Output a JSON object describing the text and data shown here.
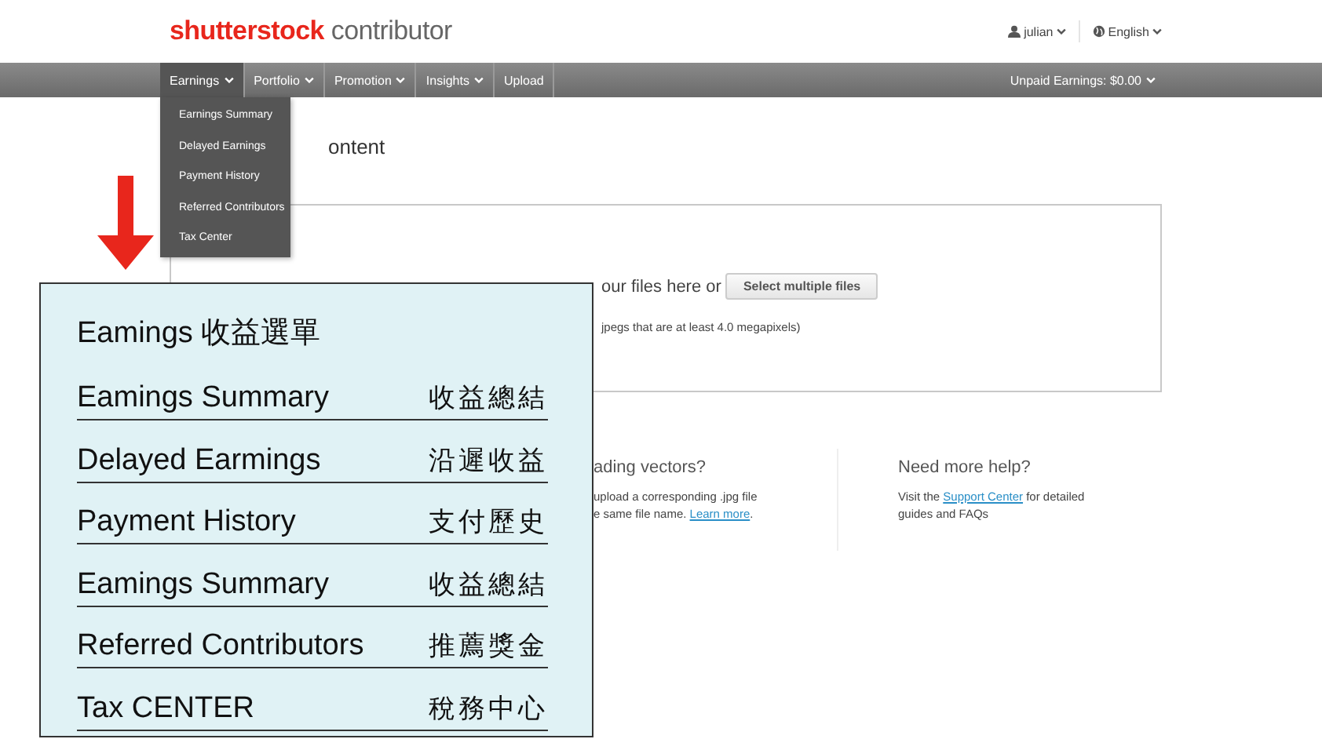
{
  "header": {
    "logo_brand": "shutterstock",
    "logo_product": "contributor",
    "user": "julian",
    "language": "English"
  },
  "nav": {
    "items": [
      {
        "label": "Earnings",
        "selected": true,
        "caret": true
      },
      {
        "label": "Portfolio",
        "selected": false,
        "caret": true
      },
      {
        "label": "Promotion",
        "selected": false,
        "caret": true
      },
      {
        "label": "Insights",
        "selected": false,
        "caret": true
      },
      {
        "label": "Upload",
        "selected": false,
        "caret": false
      }
    ],
    "unpaid": "Unpaid Earnings: $0.00"
  },
  "dropdown": [
    "Earnings Summary",
    "Delayed Earnings",
    "Payment History",
    "Referred Contributors",
    "Tax Center"
  ],
  "page": {
    "heading": "ontent",
    "upload_prompt": "our files here or",
    "upload_button": "Select multiple files",
    "upload_note": "jpegs that are at least 4.0 megapixels)"
  },
  "help": [
    {
      "title": "ading vectors?",
      "before": "upload a corresponding .jpg file\ne same file name. ",
      "link": "Learn more",
      "after": "."
    },
    {
      "title": "Need more help?",
      "before": "Visit the ",
      "link": "Support Center",
      "after": " for detailed\nguides and FAQs"
    }
  ],
  "annotation": {
    "title": "Eamings 收益選單",
    "rows": [
      {
        "en": "Eamings Summary",
        "zh": "收益總結"
      },
      {
        "en": "Delayed Earmings",
        "zh": "沿遲收益"
      },
      {
        "en": "Payment History",
        "zh": "支付歷史"
      },
      {
        "en": "Eamings Summary",
        "zh": "收益總結"
      },
      {
        "en": "Referred Contributors",
        "zh": "推薦獎金"
      },
      {
        "en": "Tax CENTER",
        "zh": "稅務中心"
      }
    ]
  }
}
